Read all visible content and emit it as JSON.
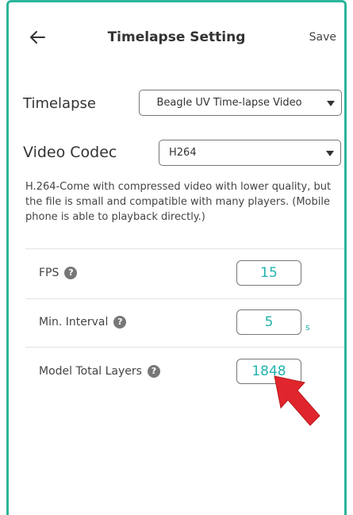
{
  "header": {
    "title": "Timelapse Setting",
    "save_label": "Save"
  },
  "timelapse": {
    "label": "Timelapse",
    "selected": "Beagle UV Time-lapse Video"
  },
  "video_codec": {
    "label": "Video Codec",
    "selected": "H264"
  },
  "description": "H.264-Come with compressed video with lower quality, but the file is small and compatible with many players. (Mobile phone is able to playback directly.)",
  "fields": {
    "fps": {
      "label": "FPS",
      "value": "15"
    },
    "min_interval": {
      "label": "Min. Interval",
      "value": "5",
      "unit": "s"
    },
    "model_total_layers": {
      "label": "Model Total Layers",
      "value": "1848"
    }
  },
  "help_glyph": "?",
  "colors": {
    "accent": "#22b3ae",
    "frame": "#2bb59a",
    "pointer_arrow": "#e0262c"
  }
}
